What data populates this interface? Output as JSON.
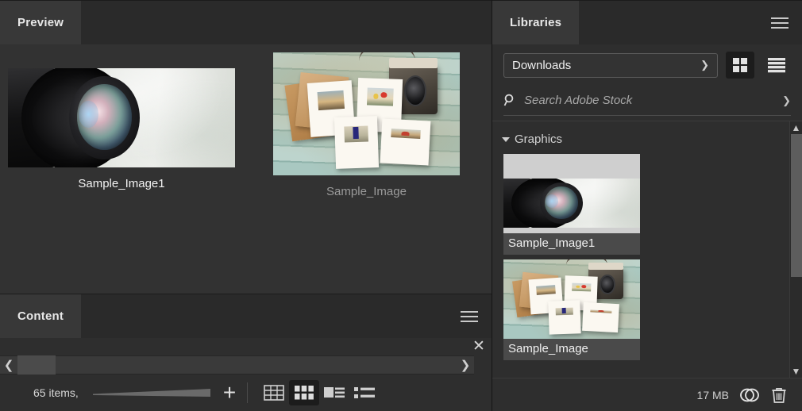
{
  "preview_panel": {
    "tab_label": "Preview",
    "items": [
      {
        "caption": "Sample_Image1",
        "selected": true,
        "art": "camera-lens"
      },
      {
        "caption": "Sample_Image",
        "selected": false,
        "art": "photos-on-wood"
      }
    ]
  },
  "content_panel": {
    "tab_label": "Content",
    "menu_icon": "hamburger-icon",
    "close_icon": "close-icon",
    "scroll_left_icon": "chevron-left-icon",
    "scroll_right_icon": "chevron-right-icon",
    "items_count_label": "65 items,",
    "zoom_slider_icon": "zoom-slider",
    "add_icon": "plus-icon",
    "view_modes": [
      {
        "name": "grid-view-icon",
        "label": "Grid",
        "active": false
      },
      {
        "name": "thumbnail-view-icon",
        "label": "Thumbnail",
        "active": true
      },
      {
        "name": "details-view-icon",
        "label": "Details",
        "active": false
      },
      {
        "name": "list-view-icon",
        "label": "List",
        "active": false
      }
    ]
  },
  "libraries_panel": {
    "tab_label": "Libraries",
    "menu_icon": "hamburger-icon",
    "library_select": {
      "value": "Downloads",
      "chevron_icon": "chevron-down-icon"
    },
    "view_buttons": [
      {
        "name": "grid-view-icon",
        "active": true
      },
      {
        "name": "list-view-icon",
        "active": false
      }
    ],
    "search": {
      "placeholder": "Search Adobe Stock",
      "icon": "search-icon",
      "chevron_icon": "chevron-down-icon"
    },
    "sections": [
      {
        "title": "Graphics",
        "expanded": true,
        "toggle_icon": "triangle-down-icon",
        "assets": [
          {
            "label": "Sample_Image1",
            "selected": true,
            "art": "camera-lens"
          },
          {
            "label": "Sample_Image",
            "selected": true,
            "art": "photos-on-wood"
          }
        ]
      }
    ],
    "scrollbar": {
      "up_icon": "chevron-up-icon",
      "down_icon": "chevron-down-icon"
    },
    "footer": {
      "size_label": "17 MB",
      "cloud_icon": "creative-cloud-icon",
      "delete_icon": "trash-icon"
    }
  },
  "colors": {
    "panel_bg": "#323232",
    "panel_bg_alt": "#2e2e2e",
    "header_bg": "#2a2a2a",
    "tab_bg": "#383838",
    "text": "#f0f0f0",
    "text_dim": "#9a9a9a",
    "selected_bg": "#4a4a4a"
  }
}
